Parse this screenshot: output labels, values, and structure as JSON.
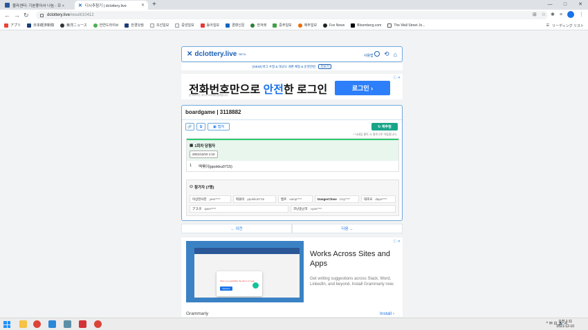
{
  "browser": {
    "tabs": [
      {
        "title": "블라센터: 기본좋아서 나눔 - 모 ×",
        "active": false
      },
      {
        "title": "디시추첨기 | dclottery.live",
        "active": true
      }
    ],
    "new_tab": "+",
    "window_controls": [
      "—",
      "□",
      "✕"
    ],
    "url_host": "dclottery.live",
    "url_path": "/result/10412",
    "bookmarks": [
      "アプリ",
      "日本経済新聞",
      "東洋ニュース",
      "한연드라이브",
      "한경닷컴",
      "조선일보",
      "중앙일보",
      "동아일보",
      "경향신문",
      "한겨레",
      "중주일보",
      "제주일보",
      "Fox News",
      "Bloomberg.com",
      "The Wall Street Jo..."
    ],
    "reading_list": "リーディング リスト"
  },
  "header": {
    "brand": "dclottery.live",
    "beta": "BETA",
    "guide": "사용법",
    "notice": "[NEW] 버그 수정 & 대규모 개편 예정 & 운영관련",
    "notice_pill": "더보기"
  },
  "ad_top": {
    "headline_pre": "전화번호만으로 ",
    "headline_hl": "안전",
    "headline_post": "한 로그인",
    "sub": "본 서비스는 패스(PASS)와 함께합니다.",
    "cta": "로그인  ›",
    "choice": "ⓘ ✕"
  },
  "result": {
    "title": "boardgame | 3118882",
    "buttons": {
      "link": "🔗",
      "copy": "⧉",
      "capture": "캡쳐"
    },
    "redraw": "재추첨",
    "hint": "* 닉네임 클릭 시 갤로그로 이동합니다.",
    "winner_title": "1회차 당첨자",
    "winner_date": "2021/12/10 1:10",
    "winners": [
      {
        "rank": "1",
        "name": "떡볶이(ppokku0715)"
      }
    ],
    "participants_title": "참가자 (7명)",
    "participants": [
      {
        "name": "이상한사진",
        "id": "yeer****"
      },
      {
        "name": "떡볶이",
        "id": "ppokku0715"
      },
      {
        "name": "뱀프",
        "id": "vamp****"
      },
      {
        "name": "DangerClose",
        "id": "rzxy****"
      },
      {
        "name": "대조모",
        "id": "dapo****"
      },
      {
        "name": "アスタ",
        "id": "qwer****"
      },
      {
        "name": "코난동난코",
        "id": "cyan****"
      }
    ]
  },
  "pager": {
    "prev": "← 이전",
    "next": "다음 →"
  },
  "ad_bottom": {
    "headline": "Works Across Sites and Apps",
    "description": "Get writing suggestions across Slack, Word, LinkedIn, and beyond. Install Grammarly now.",
    "brand": "Grammarly",
    "install": "Install  ›",
    "card_text": "there is a possibility the dot in it mean",
    "card_btn": "Replace"
  },
  "taskbar": {
    "tray": "^ ✉ ⊡ 🔊 A",
    "time": "오전 1:11",
    "date": "2021-12-10"
  },
  "colors": {
    "accent": "#1a73e8",
    "green": "#17a589",
    "brand": "#1a5fb4"
  }
}
